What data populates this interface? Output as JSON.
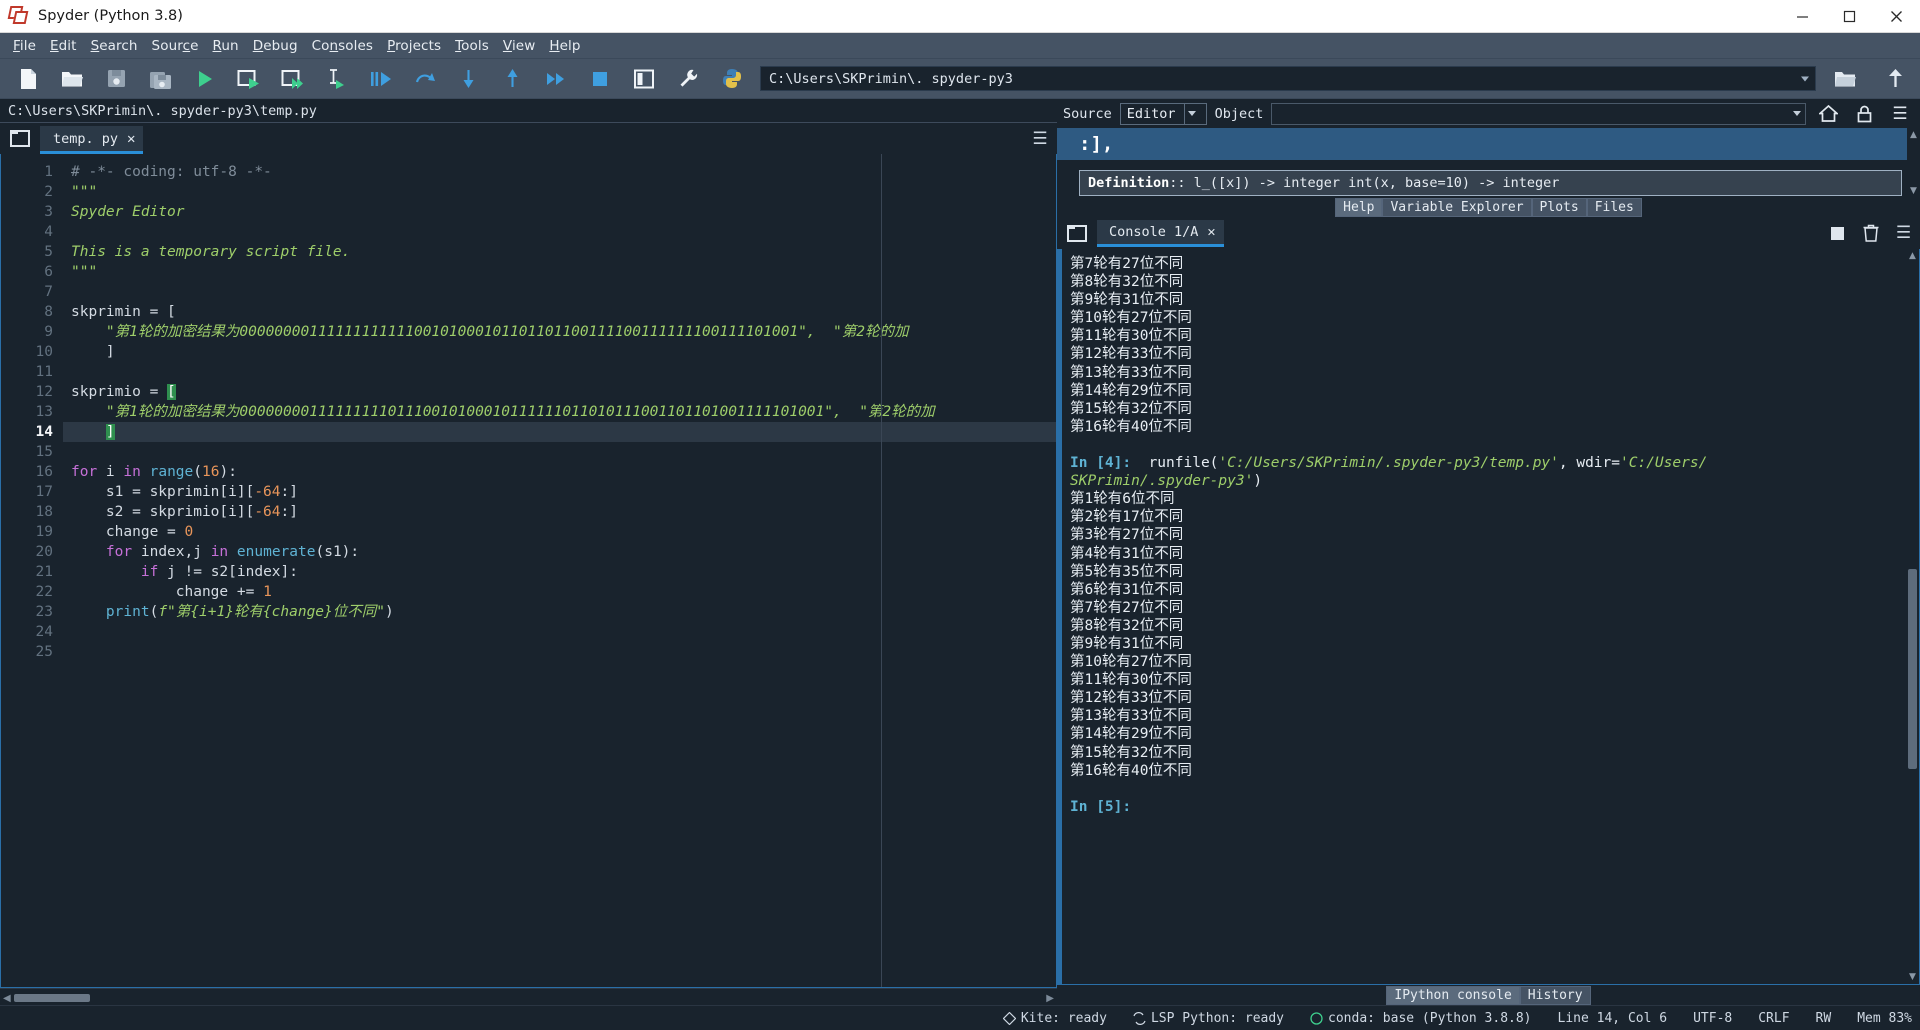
{
  "window": {
    "title": "Spyder (Python 3.8)",
    "minimize": "—",
    "maximize": "□",
    "close": "✕"
  },
  "menubar": {
    "items": [
      {
        "label": "File",
        "mnemonic": "F"
      },
      {
        "label": "Edit",
        "mnemonic": "E"
      },
      {
        "label": "Search",
        "mnemonic": "S"
      },
      {
        "label": "Source",
        "mnemonic": "c"
      },
      {
        "label": "Run",
        "mnemonic": "R"
      },
      {
        "label": "Debug",
        "mnemonic": "D"
      },
      {
        "label": "Consoles",
        "mnemonic": "n"
      },
      {
        "label": "Projects",
        "mnemonic": "P"
      },
      {
        "label": "Tools",
        "mnemonic": "T"
      },
      {
        "label": "View",
        "mnemonic": "V"
      },
      {
        "label": "Help",
        "mnemonic": "H"
      }
    ]
  },
  "toolbar": {
    "icons": [
      "new-file-icon",
      "open-file-icon",
      "save-file-icon",
      "save-all-icon",
      "run-file-icon",
      "run-cell-icon",
      "run-cell-advance-icon",
      "run-selection-icon",
      "debug-file-icon",
      "debug-step-over-icon",
      "debug-step-into-icon",
      "debug-step-return-icon",
      "debug-continue-icon",
      "debug-stop-icon",
      "maximize-pane-icon",
      "preferences-icon",
      "python-path-manager-icon"
    ],
    "path_value": "C:\\Users\\SKPrimin\\. spyder-py3",
    "right_icons": [
      "open-directory-icon",
      "parent-directory-icon"
    ]
  },
  "editor": {
    "file_path": "C:\\Users\\SKPrimin\\. spyder-py3\\temp.py",
    "browse_icon": "folder-icon",
    "options_icon": "hamburger-icon",
    "tab": {
      "label": "temp. py",
      "close": "✕"
    },
    "current_line": 14,
    "line_numbers": [
      1,
      2,
      3,
      4,
      5,
      6,
      7,
      8,
      9,
      10,
      11,
      12,
      13,
      14,
      15,
      16,
      17,
      18,
      19,
      20,
      21,
      22,
      23,
      24,
      25
    ],
    "lines": [
      {
        "n": 1,
        "type": "comment",
        "text": "# -*- coding: utf-8 -*-"
      },
      {
        "n": 2,
        "type": "doc",
        "text": "\"\"\""
      },
      {
        "n": 3,
        "type": "doc",
        "text": "Spyder Editor"
      },
      {
        "n": 4,
        "type": "doc",
        "text": ""
      },
      {
        "n": 5,
        "type": "doc",
        "text": "This is a temporary script file."
      },
      {
        "n": 6,
        "type": "doc",
        "text": "\"\"\""
      },
      {
        "n": 7,
        "type": "plain",
        "text": ""
      },
      {
        "n": 8,
        "type": "assign",
        "name": "skprimin",
        "text": "skprimin = ["
      },
      {
        "n": 9,
        "type": "string",
        "text": "    \"第1轮的加密结果为0000000011111111111100101000101101101100111100111111100111101001\",  \"第2轮的加"
      },
      {
        "n": 10,
        "type": "plain",
        "text": "    ]"
      },
      {
        "n": 11,
        "type": "plain",
        "text": ""
      },
      {
        "n": 12,
        "type": "assign",
        "name": "skprimio",
        "text": "skprimio = ["
      },
      {
        "n": 13,
        "type": "string",
        "text": "    \"第1轮的加密结果为0000000011111111101110010100010111111011010111001101101001111101001\",  \"第2轮的加"
      },
      {
        "n": 14,
        "type": "plain",
        "text": "    ]"
      },
      {
        "n": 15,
        "type": "plain",
        "text": ""
      },
      {
        "n": 16,
        "type": "for",
        "text": "for i in range(16):"
      },
      {
        "n": 17,
        "type": "plain",
        "text": "    s1 = skprimin[i][-64:]"
      },
      {
        "n": 18,
        "type": "plain",
        "text": "    s2 = skprimio[i][-64:]"
      },
      {
        "n": 19,
        "type": "plain",
        "text": "    change = 0"
      },
      {
        "n": 20,
        "type": "for",
        "text": "    for index,j in enumerate(s1):"
      },
      {
        "n": 21,
        "type": "if",
        "text": "        if j != s2[index]:"
      },
      {
        "n": 22,
        "type": "plain",
        "text": "            change += 1"
      },
      {
        "n": 23,
        "type": "print",
        "text": "    print(f\"第{i+1}轮有{change}位不同\")"
      },
      {
        "n": 24,
        "type": "plain",
        "text": ""
      },
      {
        "n": 25,
        "type": "plain",
        "text": ""
      }
    ]
  },
  "help": {
    "source_label": "Source",
    "source_value": "Editor",
    "object_label": "Object",
    "object_value": "",
    "home_icon": "home-icon",
    "lock_icon": "lock-icon",
    "options_icon": "hamburger-icon",
    "selected_text": ":],",
    "definition_label": "Definition",
    "definition_text": ":: l_([x]) -> integer int(x, base=10) -> integer",
    "tabs": [
      {
        "label": "Help",
        "active": true
      },
      {
        "label": "Variable Explorer",
        "active": false
      },
      {
        "label": "Plots",
        "active": false
      },
      {
        "label": "Files",
        "active": false
      }
    ]
  },
  "console": {
    "browse_icon": "folder-icon",
    "tab": {
      "label": "Console 1/A",
      "close": "✕"
    },
    "tools": [
      "stop-icon",
      "remove-icon",
      "hamburger-icon"
    ],
    "output_lines": [
      {
        "type": "out",
        "text": "第7轮有27位不同"
      },
      {
        "type": "out",
        "text": "第8轮有32位不同"
      },
      {
        "type": "out",
        "text": "第9轮有31位不同"
      },
      {
        "type": "out",
        "text": "第10轮有27位不同"
      },
      {
        "type": "out",
        "text": "第11轮有30位不同"
      },
      {
        "type": "out",
        "text": "第12轮有33位不同"
      },
      {
        "type": "out",
        "text": "第13轮有33位不同"
      },
      {
        "type": "out",
        "text": "第14轮有29位不同"
      },
      {
        "type": "out",
        "text": "第15轮有32位不同"
      },
      {
        "type": "out",
        "text": "第16轮有40位不同"
      },
      {
        "type": "blank",
        "text": ""
      },
      {
        "type": "in_runfile",
        "prompt": "In [4]:",
        "cmd1": "runfile(",
        "path1": "'C:/Users/SKPrimin/.spyder-py3/temp.py'",
        "mid": ", wdir=",
        "path2": "'C:/Users/",
        "path3": "SKPrimin/.spyder-py3'",
        "tail": ")"
      },
      {
        "type": "out",
        "text": "第1轮有6位不同"
      },
      {
        "type": "out",
        "text": "第2轮有17位不同"
      },
      {
        "type": "out",
        "text": "第3轮有27位不同"
      },
      {
        "type": "out",
        "text": "第4轮有31位不同"
      },
      {
        "type": "out",
        "text": "第5轮有35位不同"
      },
      {
        "type": "out",
        "text": "第6轮有31位不同"
      },
      {
        "type": "out",
        "text": "第7轮有27位不同"
      },
      {
        "type": "out",
        "text": "第8轮有32位不同"
      },
      {
        "type": "out",
        "text": "第9轮有31位不同"
      },
      {
        "type": "out",
        "text": "第10轮有27位不同"
      },
      {
        "type": "out",
        "text": "第11轮有30位不同"
      },
      {
        "type": "out",
        "text": "第12轮有33位不同"
      },
      {
        "type": "out",
        "text": "第13轮有33位不同"
      },
      {
        "type": "out",
        "text": "第14轮有29位不同"
      },
      {
        "type": "out",
        "text": "第15轮有32位不同"
      },
      {
        "type": "out",
        "text": "第16轮有40位不同"
      },
      {
        "type": "blank",
        "text": ""
      },
      {
        "type": "prompt",
        "text": "In [5]:"
      }
    ],
    "tabs": [
      {
        "label": "IPython console",
        "active": true
      },
      {
        "label": "History",
        "active": false
      }
    ]
  },
  "statusbar": {
    "kite": "Kite: ready",
    "lsp": "LSP Python: ready",
    "conda": "conda: base (Python 3.8.8)",
    "position": "Line 14, Col 6",
    "encoding": "UTF-8",
    "eol": "CRLF",
    "permissions": "RW",
    "memory": "Mem 83%"
  },
  "colors": {
    "accent": "#2a8fd8",
    "panel": "#455364",
    "background": "#19232d",
    "string": "#9ece6a",
    "keyword": "#c670d8",
    "builtin": "#5fb3d4",
    "number": "#e8955a",
    "comment": "#7f8c99",
    "selection": "#2f8f4f"
  }
}
